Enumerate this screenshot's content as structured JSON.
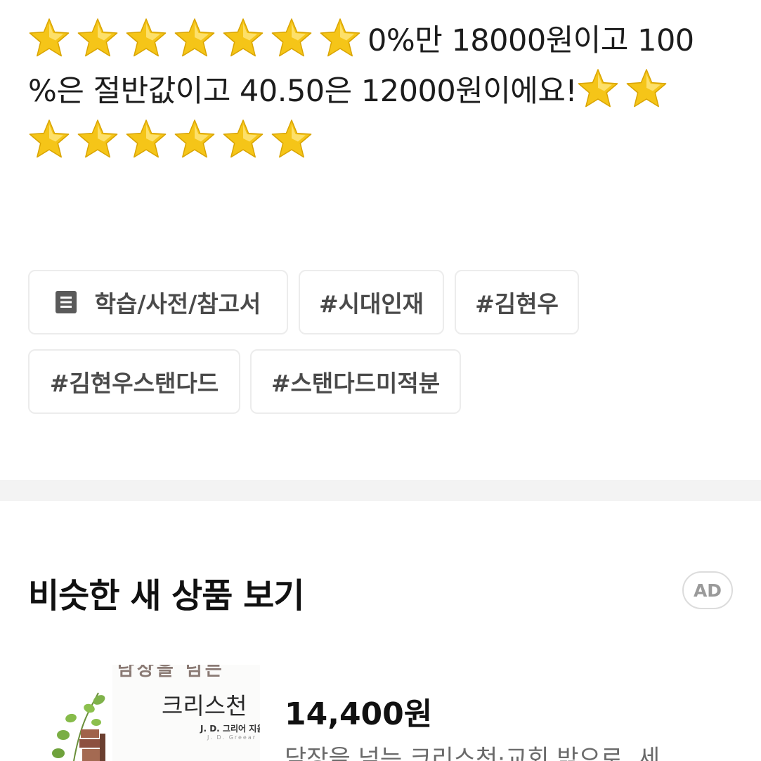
{
  "description": {
    "line1_text": "0%만 18000원이고 100",
    "line2_text": "%은 절반값이고 40.50은 12000원이에요!",
    "star_icon": "star-emoji",
    "star_color": "#F5C518",
    "stars_before_line1": 7,
    "stars_after_line2": 2,
    "stars_line3": 6
  },
  "tags": {
    "category_icon": "document-list-icon",
    "category_label": "학습/사전/참고서",
    "tag1": "#시대인재",
    "tag2": "#김현우",
    "tag3": "#김현우스탠다드",
    "tag4": "#스탠다드미적분"
  },
  "similar": {
    "title": "비슷한 새 상품 보기",
    "ad_badge": "AD"
  },
  "product": {
    "cover_top_text": "담장을 넘는",
    "cover_title": "크리스천",
    "cover_author": "J. D. 그리어 지음",
    "cover_author_en": "J. D. Greear",
    "price": "14,400원",
    "name": "담장을 넘는 크리스천·교회 밖으로, 세"
  }
}
